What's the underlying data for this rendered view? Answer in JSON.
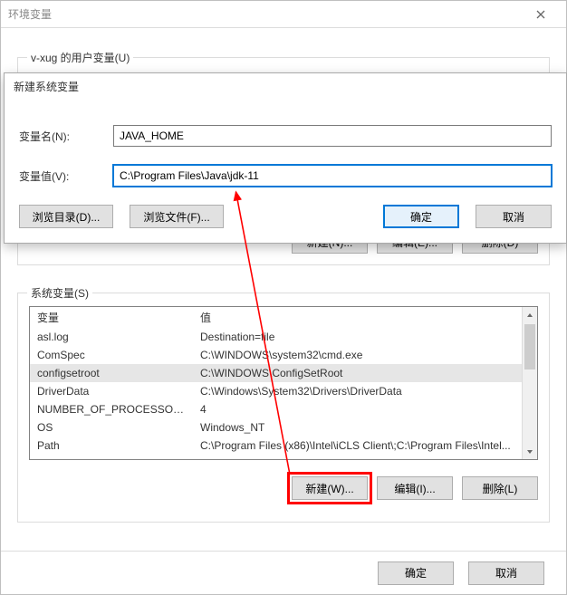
{
  "env_window": {
    "title": "环境变量",
    "user_vars": {
      "legend": "v-xug 的用户变量(U)",
      "buttons": {
        "new": "新建(N)...",
        "edit": "编辑(E)...",
        "delete": "删除(D)"
      }
    },
    "sys_vars": {
      "legend": "系统变量(S)",
      "headers": {
        "name": "变量",
        "value": "值"
      },
      "rows": [
        {
          "name": "asl.log",
          "value": "Destination=file"
        },
        {
          "name": "ComSpec",
          "value": "C:\\WINDOWS\\system32\\cmd.exe"
        },
        {
          "name": "configsetroot",
          "value": "C:\\WINDOWS\\ConfigSetRoot"
        },
        {
          "name": "DriverData",
          "value": "C:\\Windows\\System32\\Drivers\\DriverData"
        },
        {
          "name": "NUMBER_OF_PROCESSORS",
          "value": "4"
        },
        {
          "name": "OS",
          "value": "Windows_NT"
        },
        {
          "name": "Path",
          "value": "C:\\Program Files (x86)\\Intel\\iCLS Client\\;C:\\Program Files\\Intel..."
        }
      ],
      "selected_index": 2,
      "buttons": {
        "new": "新建(W)...",
        "edit": "编辑(I)...",
        "delete": "删除(L)"
      }
    },
    "ok": "确定",
    "cancel": "取消"
  },
  "new_dialog": {
    "title": "新建系统变量",
    "name_label": "变量名(N):",
    "name_value": "JAVA_HOME",
    "value_label": "变量值(V):",
    "value_value": "C:\\Program Files\\Java\\jdk-11",
    "browse_dir": "浏览目录(D)...",
    "browse_file": "浏览文件(F)...",
    "ok": "确定",
    "cancel": "取消"
  }
}
